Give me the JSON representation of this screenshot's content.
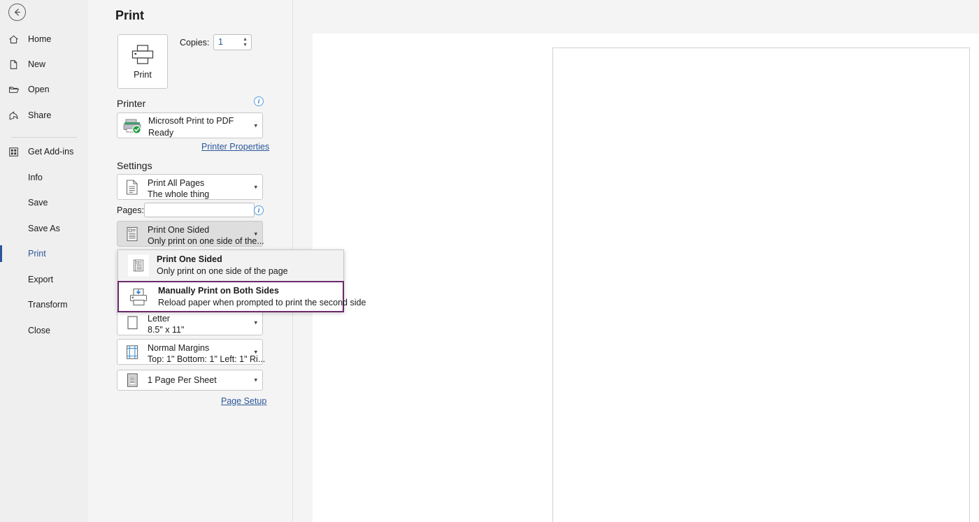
{
  "nav": {
    "back_icon": "back-arrow-icon",
    "items": [
      {
        "label": "Home",
        "icon": "home-icon",
        "active": false,
        "has_icon": true
      },
      {
        "label": "New",
        "icon": "page-icon",
        "active": false,
        "has_icon": true
      },
      {
        "label": "Open",
        "icon": "folder-icon",
        "active": false,
        "has_icon": true
      },
      {
        "label": "Share",
        "icon": "share-icon",
        "active": false,
        "has_icon": true
      },
      {
        "label": "Get Add-ins",
        "icon": "addins-icon",
        "active": false,
        "has_icon": true
      },
      {
        "label": "Info",
        "icon": "",
        "active": false,
        "has_icon": false
      },
      {
        "label": "Save",
        "icon": "",
        "active": false,
        "has_icon": false
      },
      {
        "label": "Save As",
        "icon": "",
        "active": false,
        "has_icon": false
      },
      {
        "label": "Print",
        "icon": "",
        "active": true,
        "has_icon": false
      },
      {
        "label": "Export",
        "icon": "",
        "active": false,
        "has_icon": false
      },
      {
        "label": "Transform",
        "icon": "",
        "active": false,
        "has_icon": false
      },
      {
        "label": "Close",
        "icon": "",
        "active": false,
        "has_icon": false
      }
    ]
  },
  "print": {
    "title": "Print",
    "print_button_label": "Print",
    "print_button_icon": "printer-icon",
    "copies_label": "Copies:",
    "copies_value": "1",
    "printer_section_label": "Printer",
    "printer_info_icon": "info-icon",
    "printer": {
      "name": "Microsoft Print to PDF",
      "status": "Ready",
      "icon": "printer-ready-icon"
    },
    "printer_properties_link": "Printer Properties",
    "settings_section_label": "Settings",
    "print_range": {
      "main": "Print All Pages",
      "sub": "The whole thing",
      "icon": "document-all-pages-icon"
    },
    "pages_label": "Pages:",
    "pages_value": "",
    "pages_placeholder": "",
    "pages_info_icon": "info-icon",
    "duplex": {
      "main": "Print One Sided",
      "sub": "Only print on one side of the...",
      "icon": "one-sided-icon"
    },
    "paper_size": {
      "main": "Letter",
      "sub": "8.5\" x 11\"",
      "icon": "paper-portrait-icon"
    },
    "margins": {
      "main": "Normal Margins",
      "sub": "Top: 1\" Bottom: 1\" Left: 1\" Ri...",
      "icon": "margins-icon"
    },
    "pages_per_sheet": {
      "main": "1 Page Per Sheet",
      "icon": "pages-per-sheet-icon"
    },
    "page_setup_link": "Page Setup"
  },
  "duplex_dropdown": {
    "options": [
      {
        "title": "Print One Sided",
        "desc": "Only print on one side of the page",
        "icon": "one-sided-icon",
        "selected": false,
        "highlighted": false
      },
      {
        "title": "Manually Print on Both Sides",
        "desc": "Reload paper when prompted to print the second side",
        "icon": "both-sides-icon",
        "selected": false,
        "highlighted": true
      }
    ]
  },
  "colors": {
    "accent": "#2b579a",
    "highlight_border": "#6b2a6b",
    "nav_background": "#efefef",
    "pane_background": "#f4f4f4",
    "printer_ready": "#1e9e3e"
  }
}
